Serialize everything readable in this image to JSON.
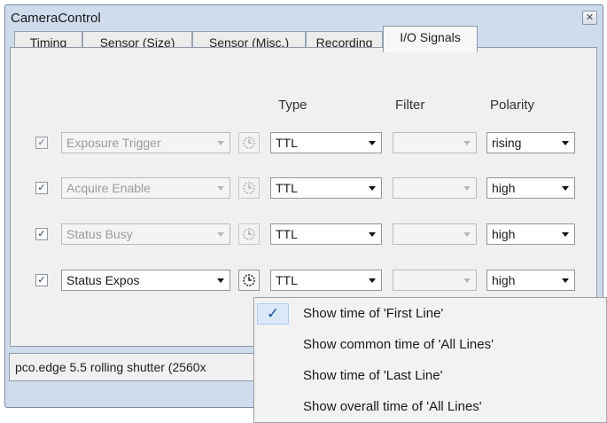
{
  "window": {
    "title": "CameraControl",
    "close_glyph": "✕"
  },
  "tabs": [
    {
      "label": "Timing"
    },
    {
      "label": "Sensor (Size)"
    },
    {
      "label": "Sensor (Misc.)"
    },
    {
      "label": "Recording"
    },
    {
      "label": "I/O Signals"
    }
  ],
  "columns": {
    "type": "Type",
    "filter": "Filter",
    "polarity": "Polarity"
  },
  "rows": [
    {
      "checked": true,
      "signal": "Exposure Trigger",
      "type": "TTL",
      "filter": "",
      "polarity": "rising",
      "enabled": false
    },
    {
      "checked": true,
      "signal": "Acquire Enable",
      "type": "TTL",
      "filter": "",
      "polarity": "high",
      "enabled": false
    },
    {
      "checked": true,
      "signal": "Status Busy",
      "type": "TTL",
      "filter": "",
      "polarity": "high",
      "enabled": false
    },
    {
      "checked": true,
      "signal": "Status Expos",
      "type": "TTL",
      "filter": "",
      "polarity": "high",
      "enabled": true
    }
  ],
  "status_text": "pco.edge 5.5 rolling shutter (2560x",
  "context_menu": {
    "items": [
      {
        "label": "Show time of 'First Line'",
        "checked": true
      },
      {
        "label": "Show common time of 'All Lines'",
        "checked": false
      },
      {
        "label": "Show time of 'Last Line'",
        "checked": false
      },
      {
        "label": "Show overall time of 'All Lines'",
        "checked": false
      }
    ],
    "check_glyph": "✓"
  },
  "check_glyph": "✓",
  "icons": {
    "row_timing_button": "clock-timing-icon"
  }
}
